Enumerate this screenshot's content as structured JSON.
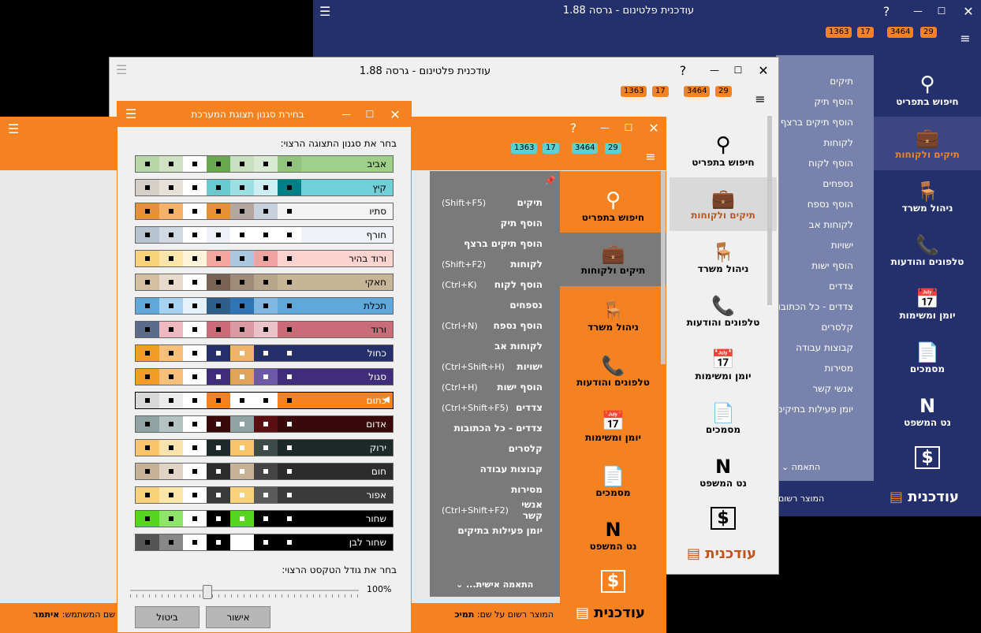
{
  "app_title": "עודכנית פלטינום - גרסה 1.88",
  "badges": {
    "b1": "1363",
    "b2": "17",
    "b3": "3464",
    "b4": "29"
  },
  "nav": {
    "search": "חיפוש בתפריט",
    "cases": "תיקים ולקוחות",
    "office": "ניהול משרד",
    "phones": "טלפונים והודעות",
    "diary": "יומן ומשימות",
    "docs": "מסמכים",
    "netlaw": "נט המשפט"
  },
  "logo_text": "עודכנית",
  "registered": "המוצר רשום",
  "registered_to": "המוצר רשום על שם:",
  "registered_name": "תמיכ",
  "username_label": "שם המשתמש:",
  "username": "איתמר",
  "customize": "התאמה",
  "customize_personal": "התאמה אישית...",
  "menu_back": [
    "תיקים",
    "הוסף תיק",
    "הוסף תיקים ברצף",
    "לקוחות",
    "הוסף לקוח",
    "נספחים",
    "הוסף נספח",
    "לקוחות אב",
    "ישויות",
    "הוסף ישות",
    "צדדים",
    "צדדים - כל הכתובות",
    "קלסרים",
    "קבוצות עבודה",
    "מסירות",
    "אנשי קשר",
    "יומן פעילות בתיקים"
  ],
  "menu_front": [
    {
      "label": "תיקים",
      "shortcut": "(Shift+F5)"
    },
    {
      "label": "הוסף תיק",
      "shortcut": ""
    },
    {
      "label": "הוסף תיקים ברצף",
      "shortcut": ""
    },
    {
      "label": "לקוחות",
      "shortcut": "(Shift+F2)"
    },
    {
      "label": "הוסף לקוח",
      "shortcut": "(Ctrl+K)"
    },
    {
      "label": "נספחים",
      "shortcut": ""
    },
    {
      "label": "הוסף נספח",
      "shortcut": "(Ctrl+N)"
    },
    {
      "label": "לקוחות אב",
      "shortcut": ""
    },
    {
      "label": "ישויות",
      "shortcut": "(Ctrl+Shift+H)"
    },
    {
      "label": "הוסף ישות",
      "shortcut": "(Ctrl+H)"
    },
    {
      "label": "צדדים",
      "shortcut": "(Ctrl+Shift+F5)"
    },
    {
      "label": "צדדים - כל הכתובות",
      "shortcut": ""
    },
    {
      "label": "קלסרים",
      "shortcut": ""
    },
    {
      "label": "קבוצות עבודה",
      "shortcut": ""
    },
    {
      "label": "מסירות",
      "shortcut": ""
    },
    {
      "label": "אנשי קשר",
      "shortcut": "(Ctrl+Shift+F2)"
    },
    {
      "label": "יומן פעילות בתיקים",
      "shortcut": ""
    }
  ],
  "dialog": {
    "title": "בחירת סגנון תצוגת המערכת",
    "prompt": "בחר את סגנון התצוגה הרצוי:",
    "size_prompt": "בחר את גודל הטקסט הרצוי:",
    "size_value": "100%",
    "ok": "אישור",
    "cancel": "ביטול",
    "themes": [
      {
        "name": "אביב",
        "bg": "#9fd08a",
        "colors": [
          "#b7d7a8",
          "#cfe2c4",
          "#ffffff",
          "#6aa84f",
          "#c9e0c0",
          "#d9ead3",
          "#93c47d"
        ],
        "selected": false
      },
      {
        "name": "קיץ",
        "bg": "#6fd0d8",
        "colors": [
          "#d6cfc7",
          "#e8e1d9",
          "#ffffff",
          "#69c9cf",
          "#9edfe3",
          "#cdeff1",
          "#007f86"
        ],
        "selected": false
      },
      {
        "name": "סתיו",
        "bg": "#f3f3f3",
        "colors": [
          "#e69138",
          "#f6b26b",
          "#ffffff",
          "#e69138",
          "#b4a7a0",
          "#c7d1de",
          "#f3f3f3"
        ],
        "selected": false
      },
      {
        "name": "חורף",
        "bg": "#eef1f6",
        "colors": [
          "#b7c3d0",
          "#d0d8e2",
          "#ffffff",
          "#eef1f6",
          "#ffffff",
          "#ffffff",
          "#ffffff"
        ],
        "selected": false
      },
      {
        "name": "ורוד בהיר",
        "bg": "#fbd3cf",
        "colors": [
          "#f9d27a",
          "#fbe5a9",
          "#fff4d9",
          "#f4a6a0",
          "#a9c7de",
          "#f2a2a0",
          "#fbd3cf"
        ],
        "selected": false
      },
      {
        "name": "חאקי",
        "bg": "#c8b497",
        "colors": [
          "#d4bfa3",
          "#e7dccb",
          "#ffffff",
          "#7a6352",
          "#9f8b77",
          "#b9a58c",
          "#c8b497"
        ],
        "selected": false
      },
      {
        "name": "תכלת",
        "bg": "#5fa8dc",
        "colors": [
          "#5fa8dc",
          "#a7d3f2",
          "#e3f2fb",
          "#2e5f8a",
          "#2e75b6",
          "#7fb7e0",
          "#5fa8dc"
        ],
        "selected": false
      },
      {
        "name": "ורוד",
        "bg": "#c96c78",
        "colors": [
          "#5b6b8a",
          "#f0b8c0",
          "#ffffff",
          "#c96c78",
          "#d99aa4",
          "#e9c3c9",
          "#c96c78"
        ],
        "selected": false
      },
      {
        "name": "כחול",
        "bg": "#25306b",
        "colors": [
          "#f39c26",
          "#f7c07a",
          "#ffffff",
          "#25306b",
          "#efb46a",
          "#25306b",
          "#25306b"
        ],
        "selected": false
      },
      {
        "name": "סגול",
        "bg": "#3f2c7a",
        "colors": [
          "#f39c26",
          "#f7c07a",
          "#ffffff",
          "#3f2c7a",
          "#e0a35a",
          "#6c5aa8",
          "#3f2c7a"
        ],
        "selected": false
      },
      {
        "name": "כתום",
        "bg": "#f58220",
        "colors": [
          "#d9d9d9",
          "#ececec",
          "#ffffff",
          "#f58220",
          "#ffffff",
          "#ffffff",
          "#f58220"
        ],
        "selected": true
      },
      {
        "name": "אדום",
        "bg": "#3a0a0a",
        "colors": [
          "#8fa3a3",
          "#b4c2c2",
          "#ffffff",
          "#3a0a0a",
          "#8fa3a3",
          "#5a1010",
          "#3a0a0a"
        ],
        "selected": false
      },
      {
        "name": "ירוק",
        "bg": "#1e2a2a",
        "colors": [
          "#f9c56b",
          "#fbe3ab",
          "#ffffff",
          "#1e2a2a",
          "#f9c56b",
          "#3c4a4a",
          "#1e2a2a"
        ],
        "selected": false
      },
      {
        "name": "חום",
        "bg": "#2c2c2c",
        "colors": [
          "#c7b299",
          "#e0d4c4",
          "#ffffff",
          "#2c2c2c",
          "#c7b299",
          "#444",
          "#2c2c2c"
        ],
        "selected": false
      },
      {
        "name": "אפור",
        "bg": "#3a3a3a",
        "colors": [
          "#f9d27a",
          "#fbe5a9",
          "#ffffff",
          "#3a3a3a",
          "#f9d27a",
          "#5a5a5a",
          "#3a3a3a"
        ],
        "selected": false
      },
      {
        "name": "שחור",
        "bg": "#000000",
        "colors": [
          "#55d51e",
          "#8ee56a",
          "#ffffff",
          "#000000",
          "#55d51e",
          "#000000",
          "#000000"
        ],
        "selected": false
      },
      {
        "name": "שחור לבן",
        "bg": "#000000",
        "colors": [
          "#555555",
          "#888888",
          "#ffffff",
          "#000000",
          "#ffffff",
          "#000000",
          "#000000"
        ],
        "selected": false
      }
    ]
  },
  "colors": {
    "navy": "#24306c",
    "orange": "#f58220",
    "gray": "#7a7a7a"
  }
}
